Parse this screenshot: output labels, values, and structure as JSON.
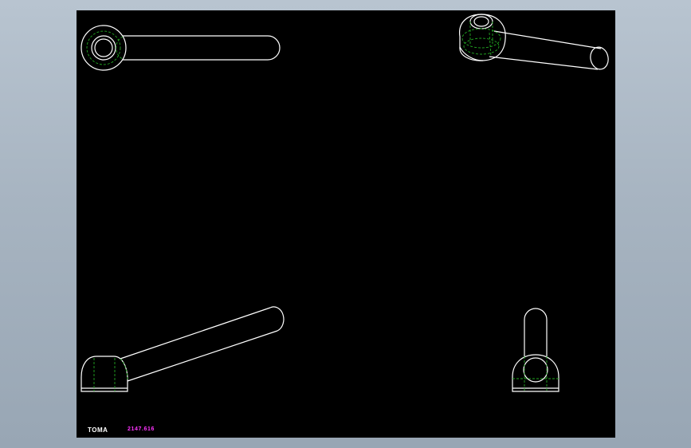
{
  "drawing": {
    "logo": "TOMA",
    "code": "2147.616",
    "colors": {
      "background": "#000000",
      "outline": "#ffffff",
      "hidden_lines": "#22a822",
      "code_text": "#ff33ff",
      "frame": "#a9b6c3"
    }
  },
  "views": [
    {
      "name": "top-view"
    },
    {
      "name": "isometric-view"
    },
    {
      "name": "front-view"
    },
    {
      "name": "side-view"
    }
  ]
}
